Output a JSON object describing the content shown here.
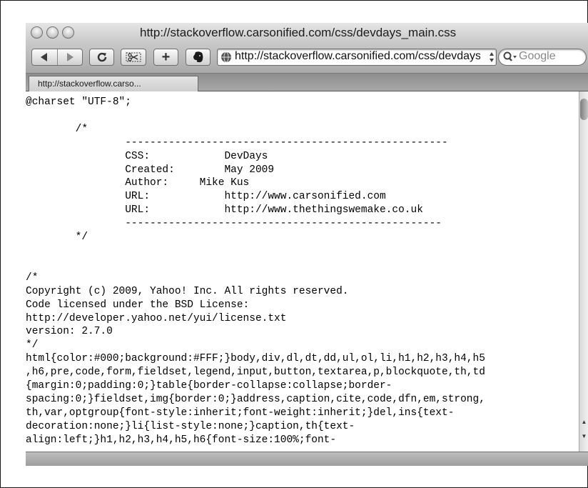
{
  "window": {
    "title": "http://stackoverflow.carsonified.com/css/devdays_main.css"
  },
  "toolbar": {
    "back_icon": "back-arrow-icon",
    "forward_icon": "forward-arrow-icon",
    "reload_icon": "reload-icon",
    "snip_icon": "scissors-icon",
    "add_bookmark_glyph": "+",
    "evernote_icon": "elephant-icon",
    "address_value": "http://stackoverflow.carsonified.com/css/devdays_main.css",
    "search_placeholder": "Google"
  },
  "tabs": [
    {
      "label": "http://stackoverflow.carso...",
      "active": true
    }
  ],
  "content": {
    "code": "@charset \"UTF-8\";\n\n        /*\n                ----------------------------------------------------\n                CSS:            DevDays\n                Created:        May 2009\n                Author:     Mike Kus\n                URL:            http://www.carsonified.com\n                URL:            http://www.thethingswemake.co.uk\n                ---------------------------------------------------\n        */\n\n\n/*\nCopyright (c) 2009, Yahoo! Inc. All rights reserved.\nCode licensed under the BSD License:\nhttp://developer.yahoo.net/yui/license.txt\nversion: 2.7.0\n*/\nhtml{color:#000;background:#FFF;}body,div,dl,dt,dd,ul,ol,li,h1,h2,h3,h4,h5\n,h6,pre,code,form,fieldset,legend,input,button,textarea,p,blockquote,th,td\n{margin:0;padding:0;}table{border-collapse:collapse;border-\nspacing:0;}fieldset,img{border:0;}address,caption,cite,code,dfn,em,strong,\nth,var,optgroup{font-style:inherit;font-weight:inherit;}del,ins{text-\ndecoration:none;}li{list-style:none;}caption,th{text-\nalign:left;}h1,h2,h3,h4,h5,h6{font-size:100%;font-"
  },
  "colors": {
    "page_background": "#ffffff",
    "chrome_gray": "#c9c9c9",
    "text": "#000000"
  }
}
